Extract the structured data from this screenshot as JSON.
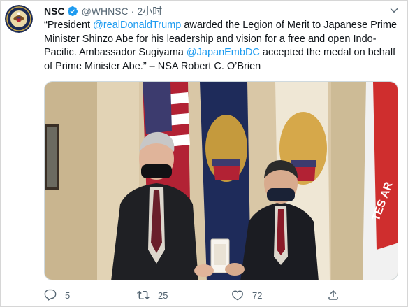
{
  "tweet": {
    "display_name": "NSC",
    "handle": "@WHNSC",
    "separator": "·",
    "time": "2小时",
    "text_segments": [
      {
        "kind": "text",
        "value": "“President "
      },
      {
        "kind": "mention",
        "value": "@realDonaldTrump"
      },
      {
        "kind": "text",
        "value": " awarded the Legion of Merit to Japanese Prime Minister Shinzo Abe for his leadership and vision for a free and open Indo-Pacific. Ambassador Sugiyama "
      },
      {
        "kind": "mention",
        "value": "@JapanEmbDC"
      },
      {
        "kind": "text",
        "value": " accepted the medal on behalf of Prime Minister Abe.” – NSA Robert C. O’Brien"
      }
    ]
  },
  "actions": {
    "reply_count": "5",
    "retweet_count": "25",
    "like_count": "72"
  },
  "colors": {
    "link": "#1d9bf0",
    "secondary_text": "#536471",
    "verified": "#1d9bf0"
  },
  "icons": [
    "nsc-seal-avatar",
    "verified-badge-icon",
    "more-options-chevron-icon",
    "reply-icon",
    "retweet-icon",
    "like-icon",
    "share-icon"
  ]
}
